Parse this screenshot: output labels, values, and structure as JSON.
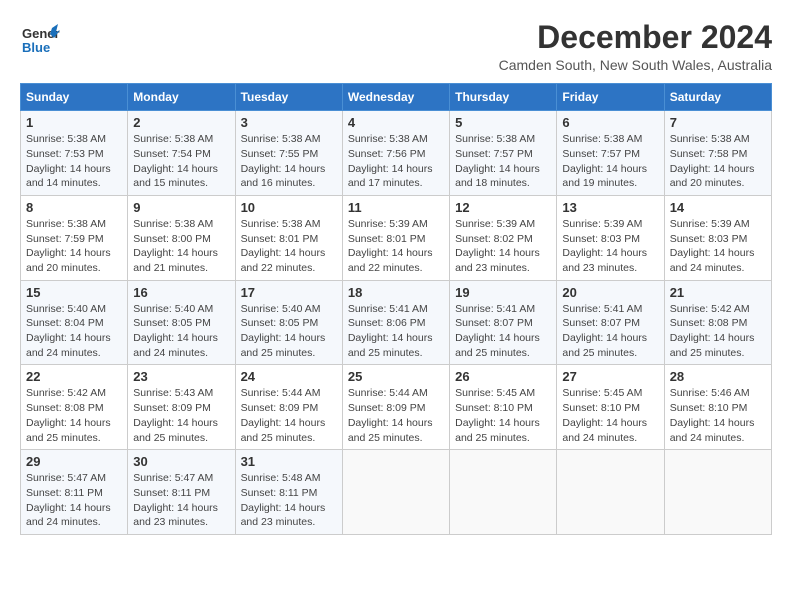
{
  "app": {
    "logo_general": "General",
    "logo_blue": "Blue"
  },
  "header": {
    "month_title": "December 2024",
    "location": "Camden South, New South Wales, Australia"
  },
  "weekdays": [
    "Sunday",
    "Monday",
    "Tuesday",
    "Wednesday",
    "Thursday",
    "Friday",
    "Saturday"
  ],
  "weeks": [
    [
      {
        "day": "1",
        "sunrise": "5:38 AM",
        "sunset": "7:53 PM",
        "daylight": "14 hours and 14 minutes."
      },
      {
        "day": "2",
        "sunrise": "5:38 AM",
        "sunset": "7:54 PM",
        "daylight": "14 hours and 15 minutes."
      },
      {
        "day": "3",
        "sunrise": "5:38 AM",
        "sunset": "7:55 PM",
        "daylight": "14 hours and 16 minutes."
      },
      {
        "day": "4",
        "sunrise": "5:38 AM",
        "sunset": "7:56 PM",
        "daylight": "14 hours and 17 minutes."
      },
      {
        "day": "5",
        "sunrise": "5:38 AM",
        "sunset": "7:57 PM",
        "daylight": "14 hours and 18 minutes."
      },
      {
        "day": "6",
        "sunrise": "5:38 AM",
        "sunset": "7:57 PM",
        "daylight": "14 hours and 19 minutes."
      },
      {
        "day": "7",
        "sunrise": "5:38 AM",
        "sunset": "7:58 PM",
        "daylight": "14 hours and 20 minutes."
      }
    ],
    [
      {
        "day": "8",
        "sunrise": "5:38 AM",
        "sunset": "7:59 PM",
        "daylight": "14 hours and 20 minutes."
      },
      {
        "day": "9",
        "sunrise": "5:38 AM",
        "sunset": "8:00 PM",
        "daylight": "14 hours and 21 minutes."
      },
      {
        "day": "10",
        "sunrise": "5:38 AM",
        "sunset": "8:01 PM",
        "daylight": "14 hours and 22 minutes."
      },
      {
        "day": "11",
        "sunrise": "5:39 AM",
        "sunset": "8:01 PM",
        "daylight": "14 hours and 22 minutes."
      },
      {
        "day": "12",
        "sunrise": "5:39 AM",
        "sunset": "8:02 PM",
        "daylight": "14 hours and 23 minutes."
      },
      {
        "day": "13",
        "sunrise": "5:39 AM",
        "sunset": "8:03 PM",
        "daylight": "14 hours and 23 minutes."
      },
      {
        "day": "14",
        "sunrise": "5:39 AM",
        "sunset": "8:03 PM",
        "daylight": "14 hours and 24 minutes."
      }
    ],
    [
      {
        "day": "15",
        "sunrise": "5:40 AM",
        "sunset": "8:04 PM",
        "daylight": "14 hours and 24 minutes."
      },
      {
        "day": "16",
        "sunrise": "5:40 AM",
        "sunset": "8:05 PM",
        "daylight": "14 hours and 24 minutes."
      },
      {
        "day": "17",
        "sunrise": "5:40 AM",
        "sunset": "8:05 PM",
        "daylight": "14 hours and 25 minutes."
      },
      {
        "day": "18",
        "sunrise": "5:41 AM",
        "sunset": "8:06 PM",
        "daylight": "14 hours and 25 minutes."
      },
      {
        "day": "19",
        "sunrise": "5:41 AM",
        "sunset": "8:07 PM",
        "daylight": "14 hours and 25 minutes."
      },
      {
        "day": "20",
        "sunrise": "5:41 AM",
        "sunset": "8:07 PM",
        "daylight": "14 hours and 25 minutes."
      },
      {
        "day": "21",
        "sunrise": "5:42 AM",
        "sunset": "8:08 PM",
        "daylight": "14 hours and 25 minutes."
      }
    ],
    [
      {
        "day": "22",
        "sunrise": "5:42 AM",
        "sunset": "8:08 PM",
        "daylight": "14 hours and 25 minutes."
      },
      {
        "day": "23",
        "sunrise": "5:43 AM",
        "sunset": "8:09 PM",
        "daylight": "14 hours and 25 minutes."
      },
      {
        "day": "24",
        "sunrise": "5:44 AM",
        "sunset": "8:09 PM",
        "daylight": "14 hours and 25 minutes."
      },
      {
        "day": "25",
        "sunrise": "5:44 AM",
        "sunset": "8:09 PM",
        "daylight": "14 hours and 25 minutes."
      },
      {
        "day": "26",
        "sunrise": "5:45 AM",
        "sunset": "8:10 PM",
        "daylight": "14 hours and 25 minutes."
      },
      {
        "day": "27",
        "sunrise": "5:45 AM",
        "sunset": "8:10 PM",
        "daylight": "14 hours and 24 minutes."
      },
      {
        "day": "28",
        "sunrise": "5:46 AM",
        "sunset": "8:10 PM",
        "daylight": "14 hours and 24 minutes."
      }
    ],
    [
      {
        "day": "29",
        "sunrise": "5:47 AM",
        "sunset": "8:11 PM",
        "daylight": "14 hours and 24 minutes."
      },
      {
        "day": "30",
        "sunrise": "5:47 AM",
        "sunset": "8:11 PM",
        "daylight": "14 hours and 23 minutes."
      },
      {
        "day": "31",
        "sunrise": "5:48 AM",
        "sunset": "8:11 PM",
        "daylight": "14 hours and 23 minutes."
      },
      null,
      null,
      null,
      null
    ]
  ]
}
